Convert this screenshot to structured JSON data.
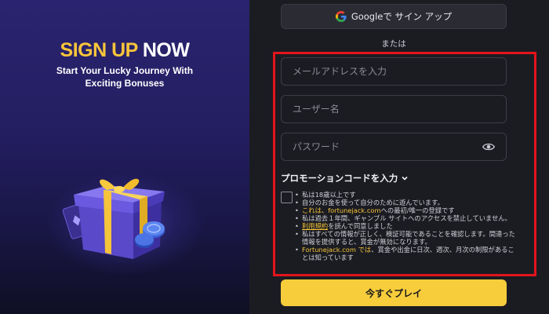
{
  "promo": {
    "headline_part1": "SIGN UP",
    "headline_part2": "NOW",
    "subtitle_line1": "Start Your Lucky Journey With",
    "subtitle_line2": "Exciting Bonuses"
  },
  "google": {
    "label": "Googleで サイン アップ",
    "icon": "google-icon"
  },
  "divider_text": "または",
  "form": {
    "email_placeholder": "メールアドレスを入力",
    "email_value": "",
    "username_placeholder": "ユーザー名",
    "username_value": "",
    "password_placeholder": "パスワード",
    "password_value": "",
    "password_icon": "eye-icon",
    "promo_code_label": "プロモーションコードを入力",
    "promo_code_icon": "chevron-down-icon"
  },
  "terms": {
    "checked": false,
    "items": [
      "私は18歳以上です",
      "自分のお金を使って自分のために遊んでいます。",
      "これは、fortunejack.comへの最初/唯一の登録です",
      "私は過去１年間、ギャンブル サイトへのアクセスを禁止していません。",
      "利用規約を読んで同意しました",
      "私はすべての情報が正しく、検証可能であることを確認します。間違った情報を提供すると、賞金が無効になります。",
      "Fortunejack.com では、賞金や出金に日次、週次、月次の制限があることは知っています"
    ],
    "item3_highlight": "これは、fortunejack.com",
    "item3_rest": "への最初/唯一の登録です",
    "item5_link": "利用規約",
    "item5_rest": "を読んで同意しました",
    "item7_highlight": "Fortunejack.com では",
    "item7_rest": "、賞金や出金に日次、週次、月次の制限があることは知っています"
  },
  "play_button": "今すぐプレイ",
  "colors": {
    "accent_yellow": "#f7cd3c",
    "highlight_red": "#e3141c",
    "background": "#1b1c22",
    "promo_purple": "#2a2470"
  }
}
